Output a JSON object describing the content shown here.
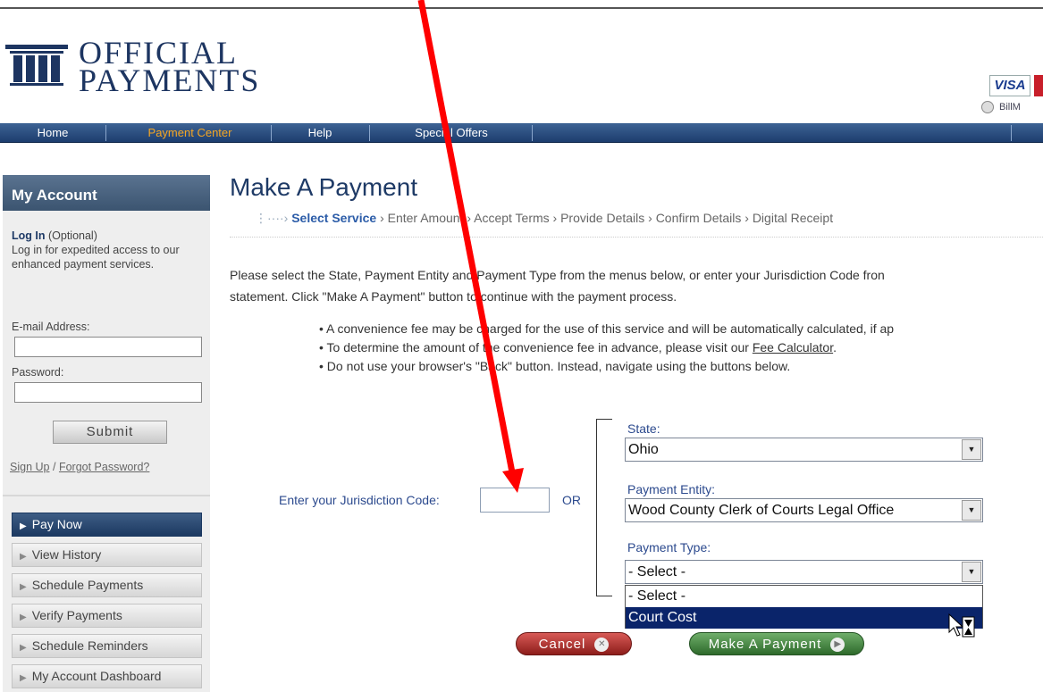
{
  "header": {
    "logo_text_line1": "OFFICIAL",
    "logo_text_line2": "PAYMENTS",
    "card_visa": "VISA",
    "billme_text": "BillM"
  },
  "nav": {
    "items": [
      {
        "label": "Home"
      },
      {
        "label": "Payment Center"
      },
      {
        "label": "Help"
      },
      {
        "label": "Special Offers"
      }
    ]
  },
  "sidebar": {
    "heading": "My Account",
    "login_title": "Log In",
    "login_optional": "(Optional)",
    "login_desc": "Log in for expedited access to our enhanced payment services.",
    "email_label": "E-mail Address:",
    "password_label": "Password:",
    "submit_label": "Submit",
    "signup_link": "Sign Up",
    "separator": "/",
    "forgot_link": "Forgot Password?",
    "menu": [
      {
        "label": "Pay Now"
      },
      {
        "label": "View History"
      },
      {
        "label": "Schedule Payments"
      },
      {
        "label": "Verify Payments"
      },
      {
        "label": "Schedule Reminders"
      },
      {
        "label": "My Account Dashboard"
      }
    ]
  },
  "main": {
    "title": "Make A Payment",
    "steps": {
      "current": "Select Service",
      "rest": "› Enter Amount › Accept Terms › Provide Details › Confirm Details › Digital Receipt"
    },
    "intro_line1": "Please select the State, Payment Entity and Payment Type from the menus below, or enter your Jurisdiction Code fron",
    "intro_line2": "statement. Click \"Make A Payment\" button to continue with the payment process.",
    "bullet1": "• A convenience fee may be charged for the use of this service and will be automatically calculated, if ap",
    "bullet2_pre": "• To determine the amount of the convenience fee in advance, please visit our",
    "bullet2_link": "Fee Calculator",
    "bullet2_post": ".",
    "bullet3": "• Do not use your browser's \"Back\" button. Instead, navigate using the buttons below.",
    "jurisdiction_label": "Enter your Jurisdiction Code:",
    "jurisdiction_value": "",
    "or_label": "OR",
    "state_label": "State:",
    "state_value": "Ohio",
    "entity_label": "Payment Entity:",
    "entity_value": "Wood County Clerk of Courts Legal Office",
    "type_label": "Payment Type:",
    "type_value": "- Select -",
    "type_options": [
      "- Select -",
      "Court Cost"
    ],
    "cancel_label": "Cancel",
    "pay_label": "Make A Payment"
  },
  "colors": {
    "nav_bg": "#1d3d6e",
    "nav_active": "#f5a623",
    "brand_blue": "#1e3a66",
    "annotation_arrow": "#ff0000",
    "dropdown_highlight": "#0a246a"
  }
}
